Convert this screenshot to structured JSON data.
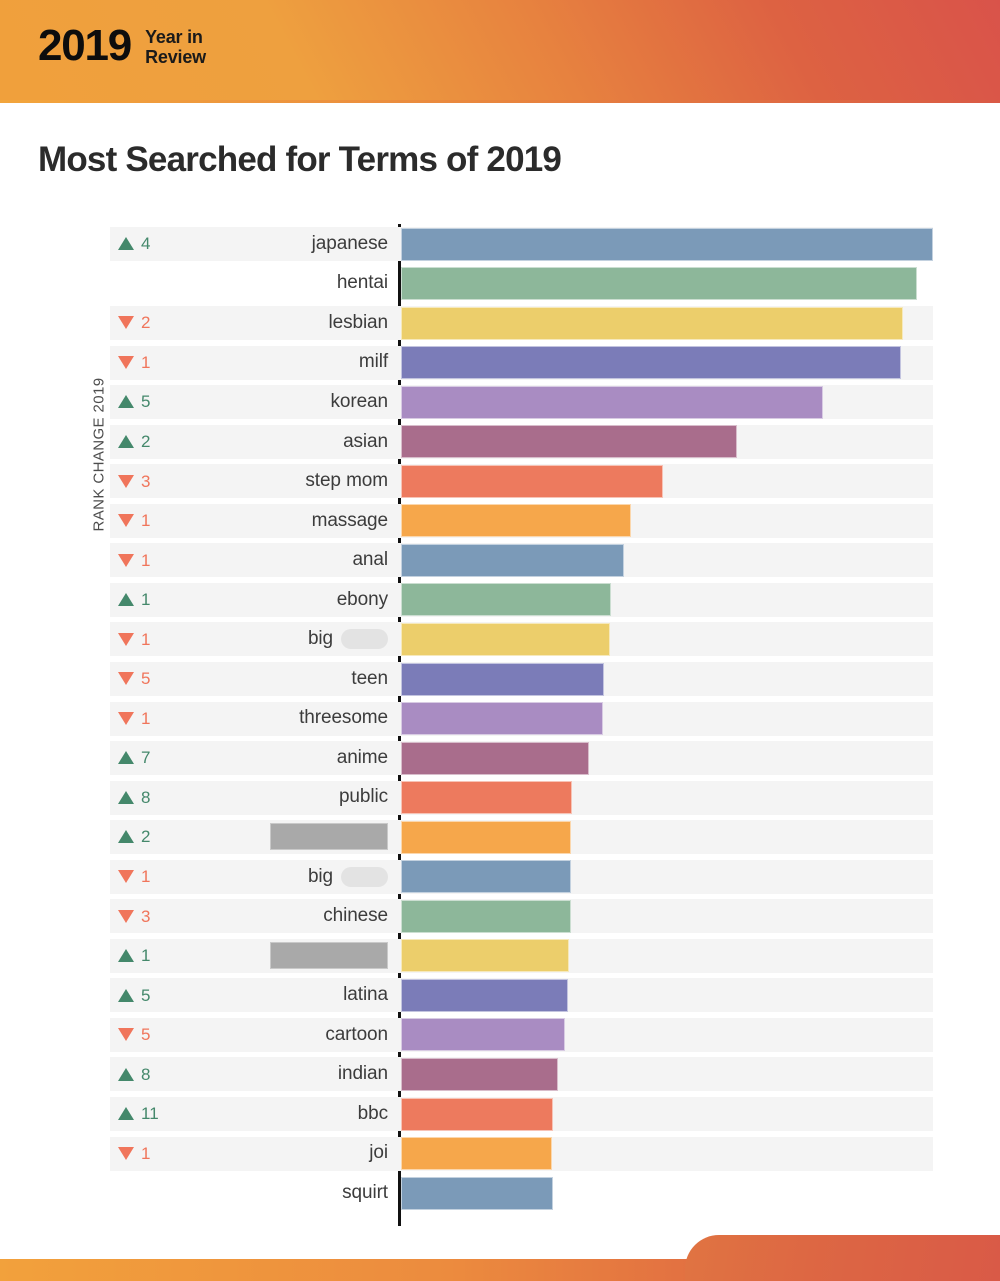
{
  "header": {
    "year": "2019",
    "subtitle_line1": "Year in",
    "subtitle_line2": "Review",
    "gradient_start": "#f0a03c",
    "gradient_end": "#d9534a"
  },
  "title": "Most Searched for Terms of 2019",
  "chart_data": {
    "type": "bar",
    "orientation": "horizontal",
    "title": "Most Searched for Terms of 2019",
    "xlabel": "",
    "ylabel": "RANK CHANGE 2019",
    "grid": false,
    "legend": "none",
    "value_unit": "relative search volume (bar length, % of max)",
    "xlim": [
      0,
      100
    ],
    "categories": [
      "japanese",
      "hentai",
      "lesbian",
      "milf",
      "korean",
      "asian",
      "step mom",
      "massage",
      "anal",
      "ebony",
      "big [redacted]",
      "teen",
      "threesome",
      "anime",
      "public",
      "[redacted]",
      "big [redacted]",
      "chinese",
      "[redacted]",
      "latina",
      "cartoon",
      "indian",
      "bbc",
      "joi",
      "squirt"
    ],
    "values": [
      100.0,
      97.0,
      94.4,
      93.9,
      79.3,
      63.2,
      49.3,
      43.2,
      41.9,
      39.5,
      39.3,
      38.2,
      38.0,
      35.4,
      32.2,
      31.9,
      31.9,
      31.9,
      31.6,
      31.3,
      30.9,
      29.5,
      28.6,
      28.4,
      28.6
    ],
    "rank_changes": [
      {
        "direction": "up",
        "value": 4
      },
      {
        "direction": "none",
        "value": null
      },
      {
        "direction": "down",
        "value": 2
      },
      {
        "direction": "down",
        "value": 1
      },
      {
        "direction": "up",
        "value": 5
      },
      {
        "direction": "up",
        "value": 2
      },
      {
        "direction": "down",
        "value": 3
      },
      {
        "direction": "down",
        "value": 1
      },
      {
        "direction": "down",
        "value": 1
      },
      {
        "direction": "up",
        "value": 1
      },
      {
        "direction": "down",
        "value": 1
      },
      {
        "direction": "down",
        "value": 5
      },
      {
        "direction": "down",
        "value": 1
      },
      {
        "direction": "up",
        "value": 7
      },
      {
        "direction": "up",
        "value": 8
      },
      {
        "direction": "up",
        "value": 2
      },
      {
        "direction": "down",
        "value": 1
      },
      {
        "direction": "down",
        "value": 3
      },
      {
        "direction": "up",
        "value": 1
      },
      {
        "direction": "up",
        "value": 5
      },
      {
        "direction": "down",
        "value": 5
      },
      {
        "direction": "up",
        "value": 8
      },
      {
        "direction": "up",
        "value": 11
      },
      {
        "direction": "down",
        "value": 1
      },
      {
        "direction": "none",
        "value": null
      }
    ],
    "palette": [
      "#7b9ab8",
      "#8db79a",
      "#ecce6b",
      "#7b7cb8",
      "#a98cc2",
      "#a96d8c",
      "#ed7a5e",
      "#f6a74b"
    ],
    "bar_colors": [
      "#7b9ab8",
      "#8db79a",
      "#ecce6b",
      "#7b7cb8",
      "#a98cc2",
      "#a96d8c",
      "#ed7a5e",
      "#f6a74b",
      "#7b9ab8",
      "#8db79a",
      "#ecce6b",
      "#7b7cb8",
      "#a98cc2",
      "#a96d8c",
      "#ed7a5e",
      "#f6a74b",
      "#7b9ab8",
      "#8db79a",
      "#ecce6b",
      "#7b7cb8",
      "#a98cc2",
      "#a96d8c",
      "#ed7a5e",
      "#f6a74b",
      "#7b9ab8"
    ]
  },
  "rows": [
    {
      "term": "japanese",
      "redact": "none",
      "rank_dir": "up",
      "rank": "4",
      "value": 100.0,
      "color": "#7b9ab8",
      "band": true
    },
    {
      "term": "hentai",
      "redact": "none",
      "rank_dir": "none",
      "rank": "",
      "value": 97.0,
      "color": "#8db79a",
      "band": false
    },
    {
      "term": "lesbian",
      "redact": "none",
      "rank_dir": "down",
      "rank": "2",
      "value": 94.4,
      "color": "#ecce6b",
      "band": true
    },
    {
      "term": "milf",
      "redact": "none",
      "rank_dir": "down",
      "rank": "1",
      "value": 93.9,
      "color": "#7b7cb8",
      "band": true
    },
    {
      "term": "korean",
      "redact": "none",
      "rank_dir": "up",
      "rank": "5",
      "value": 79.3,
      "color": "#a98cc2",
      "band": true
    },
    {
      "term": "asian",
      "redact": "none",
      "rank_dir": "up",
      "rank": "2",
      "value": 63.2,
      "color": "#a96d8c",
      "band": true
    },
    {
      "term": "step mom",
      "redact": "none",
      "rank_dir": "down",
      "rank": "3",
      "value": 49.3,
      "color": "#ed7a5e",
      "band": true
    },
    {
      "term": "massage",
      "redact": "none",
      "rank_dir": "down",
      "rank": "1",
      "value": 43.2,
      "color": "#f6a74b",
      "band": true
    },
    {
      "term": "anal",
      "redact": "none",
      "rank_dir": "down",
      "rank": "1",
      "value": 41.9,
      "color": "#7b9ab8",
      "band": true
    },
    {
      "term": "ebony",
      "redact": "none",
      "rank_dir": "up",
      "rank": "1",
      "value": 39.5,
      "color": "#8db79a",
      "band": true
    },
    {
      "term": "big",
      "redact": "pill",
      "rank_dir": "down",
      "rank": "1",
      "value": 39.3,
      "color": "#ecce6b",
      "band": true
    },
    {
      "term": "teen",
      "redact": "none",
      "rank_dir": "down",
      "rank": "5",
      "value": 38.2,
      "color": "#7b7cb8",
      "band": true
    },
    {
      "term": "threesome",
      "redact": "none",
      "rank_dir": "down",
      "rank": "1",
      "value": 38.0,
      "color": "#a98cc2",
      "band": true
    },
    {
      "term": "anime",
      "redact": "none",
      "rank_dir": "up",
      "rank": "7",
      "value": 35.4,
      "color": "#a96d8c",
      "band": true
    },
    {
      "term": "public",
      "redact": "none",
      "rank_dir": "up",
      "rank": "8",
      "value": 32.2,
      "color": "#ed7a5e",
      "band": true
    },
    {
      "term": "",
      "redact": "box",
      "rank_dir": "up",
      "rank": "2",
      "value": 31.9,
      "color": "#f6a74b",
      "band": true
    },
    {
      "term": "big",
      "redact": "pill",
      "rank_dir": "down",
      "rank": "1",
      "value": 31.9,
      "color": "#7b9ab8",
      "band": true
    },
    {
      "term": "chinese",
      "redact": "none",
      "rank_dir": "down",
      "rank": "3",
      "value": 31.9,
      "color": "#8db79a",
      "band": true
    },
    {
      "term": "",
      "redact": "box",
      "rank_dir": "up",
      "rank": "1",
      "value": 31.6,
      "color": "#ecce6b",
      "band": true
    },
    {
      "term": "latina",
      "redact": "none",
      "rank_dir": "up",
      "rank": "5",
      "value": 31.3,
      "color": "#7b7cb8",
      "band": true
    },
    {
      "term": "cartoon",
      "redact": "none",
      "rank_dir": "down",
      "rank": "5",
      "value": 30.9,
      "color": "#a98cc2",
      "band": true
    },
    {
      "term": "indian",
      "redact": "none",
      "rank_dir": "up",
      "rank": "8",
      "value": 29.5,
      "color": "#a96d8c",
      "band": true
    },
    {
      "term": "bbc",
      "redact": "none",
      "rank_dir": "up",
      "rank": "11",
      "value": 28.6,
      "color": "#ed7a5e",
      "band": true
    },
    {
      "term": "joi",
      "redact": "none",
      "rank_dir": "down",
      "rank": "1",
      "value": 28.4,
      "color": "#f6a74b",
      "band": true
    },
    {
      "term": "squirt",
      "redact": "none",
      "rank_dir": "none",
      "rank": "",
      "value": 28.6,
      "color": "#7b9ab8",
      "band": false
    }
  ],
  "footer": {
    "gradient_start": "#f2a13c",
    "gradient_end": "#d95a47"
  }
}
